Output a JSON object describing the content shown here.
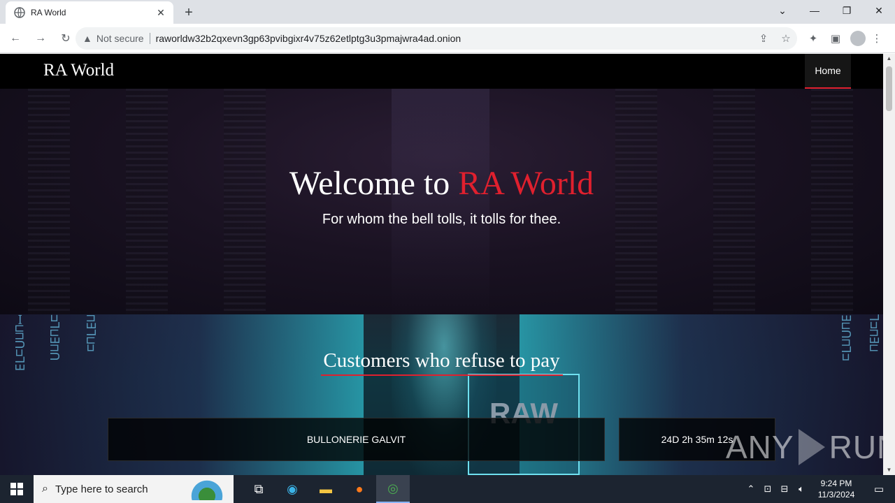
{
  "browser": {
    "tab_title": "RA World",
    "security_label": "Not secure",
    "url": "raworldw32b2qxevn3gp63pvibgixr4v75z62etlptg3u3pmajwra4ad.onion"
  },
  "site": {
    "brand": "RA World",
    "nav_home": "Home",
    "hero_title_prefix": "Welcome to",
    "hero_title_accent": "RA World",
    "hero_tagline": "For whom the bell tolls, it tolls for thee.",
    "section_title": "Customers who refuse to pay",
    "image_text": "RAW",
    "victims": [
      {
        "name": "BULLONERIE GALVIT",
        "countdown": "24D 2h 35m 12s"
      }
    ]
  },
  "watermark": {
    "left": "ANY",
    "right": "RUN"
  },
  "taskbar": {
    "search_placeholder": "Type here to search",
    "time": "9:24 PM",
    "date": "11/3/2024"
  },
  "colors": {
    "accent": "#e0202e",
    "nav_bg": "#000000",
    "taskbar_bg": "#1c2430"
  },
  "icons": {
    "tab_favicon": "globe-icon",
    "security": "warning-triangle-icon"
  }
}
